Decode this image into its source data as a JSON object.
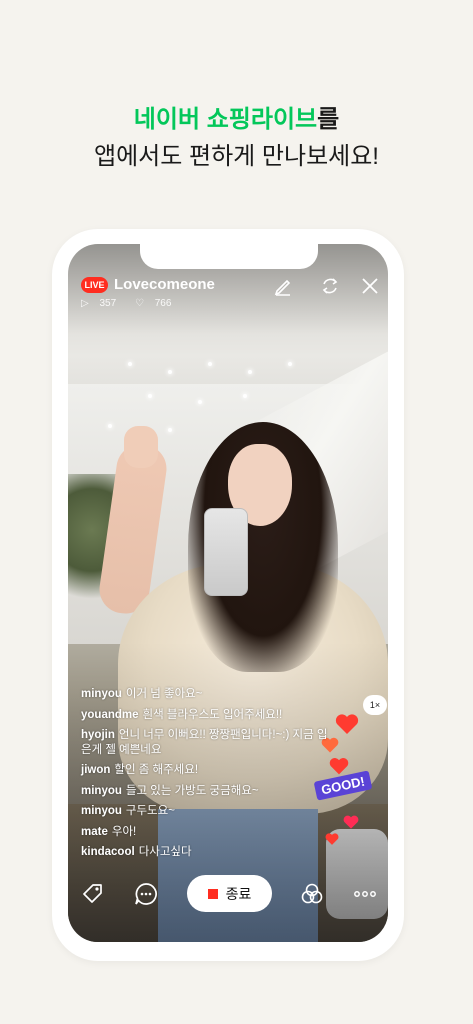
{
  "headline": {
    "line1_green": "네이버 쇼핑라이브",
    "line1_rest": "를",
    "line2": "앱에서도 편하게 만나보세요!"
  },
  "live": {
    "badge": "LIVE",
    "channel_name": "Lovecomeone",
    "plays": "357",
    "likes": "766",
    "speed": "1×"
  },
  "comments": [
    {
      "user": "minyou",
      "text": "이거 넘 좋아요~"
    },
    {
      "user": "youandme",
      "text": "흰색 블라우스도 입어주세요!!"
    },
    {
      "user": "hyojin",
      "text": "언니 너무 이뻐요!! 짱짱팬입니다!~:) 지금 입은게 젤 예쁜네요"
    },
    {
      "user": "jiwon",
      "text": "할인 좀 해주세요!"
    },
    {
      "user": "minyou",
      "text": "들고 있는 가방도 궁금해요~"
    },
    {
      "user": "minyou",
      "text": "구두도요~"
    },
    {
      "user": "mate",
      "text": "우아!"
    },
    {
      "user": "kindacool",
      "text": "다사고싶다"
    }
  ],
  "controls": {
    "end_label": "종료",
    "good_sticker": "GOOD!"
  },
  "colors": {
    "naver_green": "#03c75a",
    "live_red": "#ff2d20",
    "good_purple": "#5a43d6"
  },
  "icons": [
    "edit-icon",
    "rotate-camera-icon",
    "close-icon",
    "tag-icon",
    "chat-icon",
    "filter-icon",
    "more-icon"
  ]
}
